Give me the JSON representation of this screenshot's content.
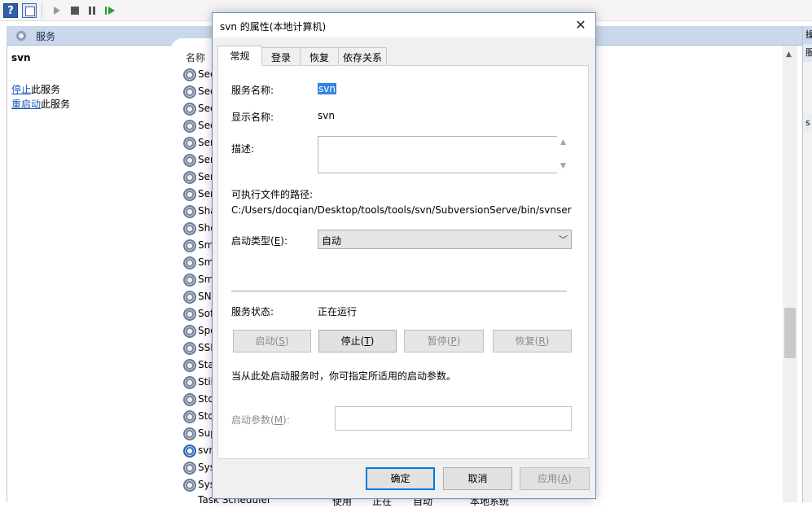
{
  "toolbar": {
    "help_glyph": "?",
    "icons": [
      "help-icon",
      "console-icon",
      "start-service-icon",
      "stop-service-icon",
      "pause-service-icon",
      "restart-service-icon"
    ]
  },
  "services_header": {
    "title": "服务"
  },
  "selected_service": {
    "name": "svn",
    "stop_link": "停止",
    "stop_suffix": "此服务",
    "restart_link": "重启动",
    "restart_suffix": "此服务"
  },
  "service_list": {
    "column_name": "名称",
    "rows": [
      "Sec",
      "Sec",
      "Sec",
      "Sec",
      "Ser",
      "Ser",
      "Ser",
      "Ser",
      "Sha",
      "She",
      "Sm",
      "Sm",
      "Sm",
      "SN",
      "Sof",
      "Spo",
      "SSD",
      "Sta",
      "Stil",
      "Sto",
      "Sto",
      "Sup",
      "svn",
      "Sys",
      "Sys"
    ],
    "bottom_row": {
      "name": "Task Scheduler",
      "desc": "使用",
      "status": "正在",
      "startup": "自动",
      "logon": "本地系统"
    }
  },
  "right_pane": {
    "head": "操",
    "item1": "服",
    "item2": "s"
  },
  "dialog": {
    "title": "svn 的属性(本地计算机)",
    "close_glyph": "✕",
    "tabs": [
      "常规",
      "登录",
      "恢复",
      "依存关系"
    ],
    "general": {
      "service_name_label": "服务名称:",
      "service_name_value": "svn",
      "display_name_label": "显示名称:",
      "display_name_value": "svn",
      "description_label": "描述:",
      "description_value": "",
      "path_label": "可执行文件的路径:",
      "path_value": "C:/Users/docqian/Desktop/tools/tools/svn/SubversionServe/bin/svnserve.exe",
      "startup_type_label_prefix": "启动类型(",
      "startup_type_label_key": "E",
      "startup_type_label_suffix": "):",
      "startup_type_value": "自动",
      "status_label": "服务状态:",
      "status_value": "正在运行",
      "buttons": {
        "start": {
          "text": "启动(",
          "key": "S",
          "tail": ")"
        },
        "stop": {
          "text": "停止(",
          "key": "T",
          "tail": ")"
        },
        "pause": {
          "text": "暂停(",
          "key": "P",
          "tail": ")"
        },
        "resume": {
          "text": "恢复(",
          "key": "R",
          "tail": ")"
        }
      },
      "start_param_note": "当从此处启动服务时，你可指定所适用的启动参数。",
      "start_param_label_prefix": "启动参数(",
      "start_param_label_key": "M",
      "start_param_label_suffix": "):",
      "start_param_value": ""
    },
    "footer": {
      "ok": "确定",
      "cancel": "取消",
      "apply_prefix": "应用(",
      "apply_key": "A",
      "apply_suffix": ")"
    }
  }
}
